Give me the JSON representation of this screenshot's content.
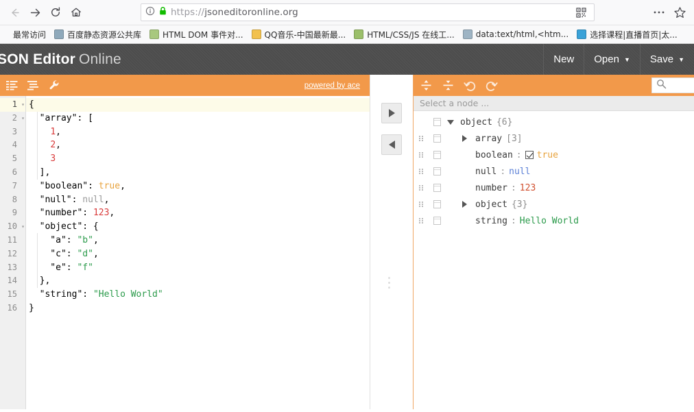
{
  "browser": {
    "nav": {
      "back_icon": "back-arrow-icon",
      "forward_icon": "forward-arrow-icon",
      "reload_icon": "reload-icon",
      "home_icon": "home-icon"
    },
    "url_bar": {
      "info_icon": "page-info-icon",
      "lock_icon": "padlock-icon",
      "scheme": "https://",
      "host": "jsoneditoronline.org",
      "qr_icon": "qr-code-icon"
    },
    "toolbar": {
      "menu_icon": "ellipsis-menu-icon",
      "bookmark_icon": "star-icon"
    },
    "bookmarks": [
      {
        "label": "最常访问",
        "icon_color": "#ffffff"
      },
      {
        "label": "百度静态资源公共库",
        "icon_color": "#8fa9bb"
      },
      {
        "label": "HTML DOM 事件对...",
        "icon_color": "#a8c87e"
      },
      {
        "label": "QQ音乐-中国最新最...",
        "icon_color": "#f2c14e"
      },
      {
        "label": "HTML/CSS/JS 在线工...",
        "icon_color": "#9bbf6a"
      },
      {
        "label": "data:text/html,<htm...",
        "icon_color": "#9eb4c4"
      },
      {
        "label": "选择课程|直播首页|太...",
        "icon_color": "#3aa2d8"
      }
    ]
  },
  "app": {
    "title_main": "SON Editor",
    "title_light": "Online",
    "menu": [
      {
        "label": "New",
        "caret": ""
      },
      {
        "label": "Open",
        "caret": "▼"
      },
      {
        "label": "Save",
        "caret": "▼"
      }
    ]
  },
  "editor": {
    "toolbar": {
      "compact_icon": "compact-json-icon",
      "format_icon": "format-json-icon",
      "repair_icon": "wrench-repair-icon",
      "powered_by": "powered by ace"
    },
    "lines": [
      {
        "n": "1",
        "fold": "▾",
        "active": true,
        "indent": 0,
        "tokens": [
          {
            "t": "{",
            "c": "tok-punc"
          }
        ]
      },
      {
        "n": "2",
        "fold": "▾",
        "active": false,
        "indent": 1,
        "tokens": [
          {
            "t": "  \"array\"",
            "c": "tok-key"
          },
          {
            "t": ": [",
            "c": "tok-punc"
          }
        ]
      },
      {
        "n": "3",
        "fold": "",
        "active": false,
        "indent": 2,
        "tokens": [
          {
            "t": "    ",
            "c": "tok-punc"
          },
          {
            "t": "1",
            "c": "tok-num"
          },
          {
            "t": ",",
            "c": "tok-punc"
          }
        ]
      },
      {
        "n": "4",
        "fold": "",
        "active": false,
        "indent": 2,
        "tokens": [
          {
            "t": "    ",
            "c": "tok-punc"
          },
          {
            "t": "2",
            "c": "tok-num"
          },
          {
            "t": ",",
            "c": "tok-punc"
          }
        ]
      },
      {
        "n": "5",
        "fold": "",
        "active": false,
        "indent": 2,
        "tokens": [
          {
            "t": "    ",
            "c": "tok-punc"
          },
          {
            "t": "3",
            "c": "tok-num"
          }
        ]
      },
      {
        "n": "6",
        "fold": "",
        "active": false,
        "indent": 1,
        "tokens": [
          {
            "t": "  ],",
            "c": "tok-punc"
          }
        ]
      },
      {
        "n": "7",
        "fold": "",
        "active": false,
        "indent": 1,
        "tokens": [
          {
            "t": "  \"boolean\"",
            "c": "tok-key"
          },
          {
            "t": ": ",
            "c": "tok-punc"
          },
          {
            "t": "true",
            "c": "tok-bool"
          },
          {
            "t": ",",
            "c": "tok-punc"
          }
        ]
      },
      {
        "n": "8",
        "fold": "",
        "active": false,
        "indent": 1,
        "tokens": [
          {
            "t": "  \"null\"",
            "c": "tok-key"
          },
          {
            "t": ": ",
            "c": "tok-punc"
          },
          {
            "t": "null",
            "c": "tok-null"
          },
          {
            "t": ",",
            "c": "tok-punc"
          }
        ]
      },
      {
        "n": "9",
        "fold": "",
        "active": false,
        "indent": 1,
        "tokens": [
          {
            "t": "  \"number\"",
            "c": "tok-key"
          },
          {
            "t": ": ",
            "c": "tok-punc"
          },
          {
            "t": "123",
            "c": "tok-num"
          },
          {
            "t": ",",
            "c": "tok-punc"
          }
        ]
      },
      {
        "n": "10",
        "fold": "▾",
        "active": false,
        "indent": 1,
        "tokens": [
          {
            "t": "  \"object\"",
            "c": "tok-key"
          },
          {
            "t": ": {",
            "c": "tok-punc"
          }
        ]
      },
      {
        "n": "11",
        "fold": "",
        "active": false,
        "indent": 2,
        "tokens": [
          {
            "t": "    \"a\"",
            "c": "tok-key"
          },
          {
            "t": ": ",
            "c": "tok-punc"
          },
          {
            "t": "\"b\"",
            "c": "tok-str"
          },
          {
            "t": ",",
            "c": "tok-punc"
          }
        ]
      },
      {
        "n": "12",
        "fold": "",
        "active": false,
        "indent": 2,
        "tokens": [
          {
            "t": "    \"c\"",
            "c": "tok-key"
          },
          {
            "t": ": ",
            "c": "tok-punc"
          },
          {
            "t": "\"d\"",
            "c": "tok-str"
          },
          {
            "t": ",",
            "c": "tok-punc"
          }
        ]
      },
      {
        "n": "13",
        "fold": "",
        "active": false,
        "indent": 2,
        "tokens": [
          {
            "t": "    \"e\"",
            "c": "tok-key"
          },
          {
            "t": ": ",
            "c": "tok-punc"
          },
          {
            "t": "\"f\"",
            "c": "tok-str"
          }
        ]
      },
      {
        "n": "14",
        "fold": "",
        "active": false,
        "indent": 1,
        "tokens": [
          {
            "t": "  },",
            "c": "tok-punc"
          }
        ]
      },
      {
        "n": "15",
        "fold": "",
        "active": false,
        "indent": 1,
        "tokens": [
          {
            "t": "  \"string\"",
            "c": "tok-key"
          },
          {
            "t": ": ",
            "c": "tok-punc"
          },
          {
            "t": "\"Hello World\"",
            "c": "tok-str"
          }
        ]
      },
      {
        "n": "16",
        "fold": "",
        "active": false,
        "indent": 0,
        "tokens": [
          {
            "t": "}",
            "c": "tok-punc"
          }
        ]
      }
    ]
  },
  "transfer": {
    "to_tree_icon": "arrow-right-icon",
    "to_code_icon": "arrow-left-icon",
    "splitter_icon": "vertical-drag-handle-icon"
  },
  "tree": {
    "toolbar": {
      "expand_icon": "expand-all-icon",
      "collapse_icon": "collapse-all-icon",
      "undo_icon": "undo-icon",
      "redo_icon": "redo-icon",
      "search_icon": "search-icon",
      "search_value": "",
      "search_placeholder": ""
    },
    "path_bar": "Select a node ...",
    "rows": [
      {
        "depth": 0,
        "drag": false,
        "expander": "down",
        "field": "object",
        "sep": "",
        "count": "{6}",
        "value": "",
        "value_class": "",
        "checkbox": false
      },
      {
        "depth": 1,
        "drag": true,
        "expander": "right",
        "field": "array",
        "sep": "",
        "count": "[3]",
        "value": "",
        "value_class": "",
        "checkbox": false
      },
      {
        "depth": 1,
        "drag": true,
        "expander": "none",
        "field": "boolean",
        "sep": ":",
        "count": "",
        "value": "true",
        "value_class": "v-bool",
        "checkbox": true
      },
      {
        "depth": 1,
        "drag": true,
        "expander": "none",
        "field": "null",
        "sep": ":",
        "count": "",
        "value": "null",
        "value_class": "v-null",
        "checkbox": false
      },
      {
        "depth": 1,
        "drag": true,
        "expander": "none",
        "field": "number",
        "sep": ":",
        "count": "",
        "value": "123",
        "value_class": "v-num",
        "checkbox": false
      },
      {
        "depth": 1,
        "drag": true,
        "expander": "right",
        "field": "object",
        "sep": "",
        "count": "{3}",
        "value": "",
        "value_class": "",
        "checkbox": false
      },
      {
        "depth": 1,
        "drag": true,
        "expander": "none",
        "field": "string",
        "sep": ":",
        "count": "",
        "value": "Hello World",
        "value_class": "v-str",
        "checkbox": false
      }
    ]
  },
  "colors": {
    "accent": "#f2994a",
    "header": "#4d4d4d",
    "active_line": "#fdfbe8"
  }
}
